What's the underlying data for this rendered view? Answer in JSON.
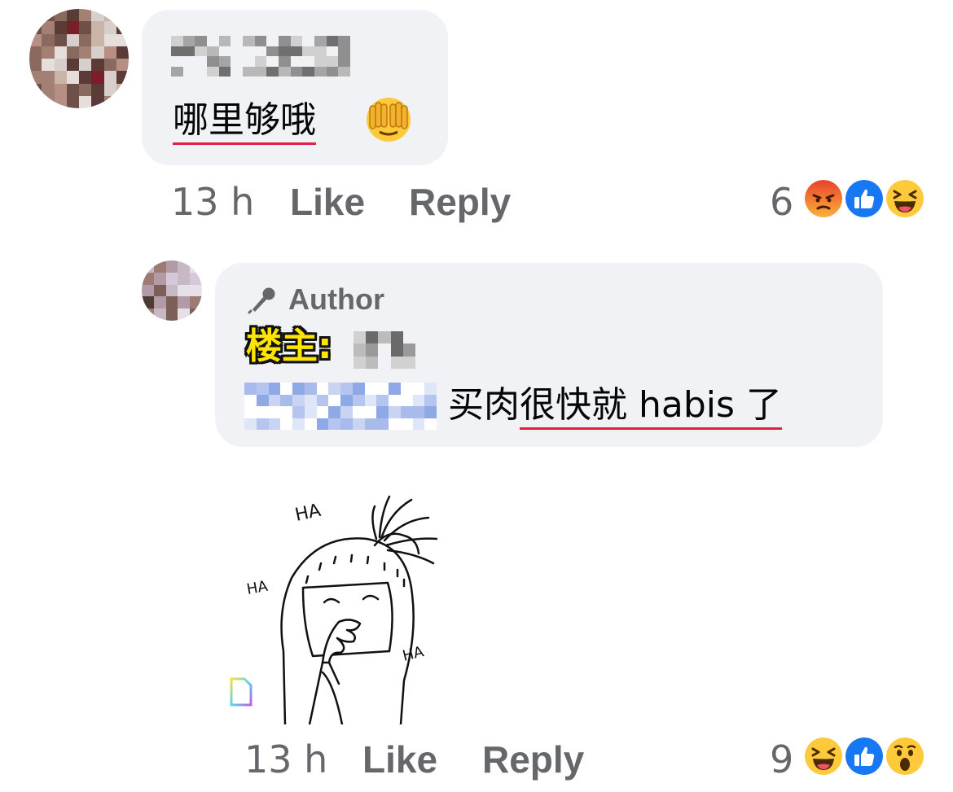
{
  "comment": {
    "author_name": "",
    "text": "哪里够哦",
    "emoji": "face-with-hands-over-eyes",
    "time": "13 h",
    "like_label": "Like",
    "reply_label": "Reply",
    "reaction_count": "6",
    "reactions": [
      "angry",
      "like",
      "haha"
    ]
  },
  "reply": {
    "badge_label": "Author",
    "op_tag": "楼主:",
    "mention_name": "",
    "text": "买肉很快就 habis 了",
    "sticker": "laughing-hood-character-sticker",
    "sticker_words": [
      "HA",
      "HA",
      "HA"
    ],
    "time": "13 h",
    "like_label": "Like",
    "reply_label": "Reply",
    "reaction_count": "9",
    "reactions": [
      "haha",
      "like",
      "wow"
    ]
  },
  "colors": {
    "bubble": "#f0f2f5",
    "meta_text": "#65676b",
    "like_blue": "#1877f2",
    "spell_underline": "#e41e3f",
    "op_tag_fill": "#ffe400"
  }
}
